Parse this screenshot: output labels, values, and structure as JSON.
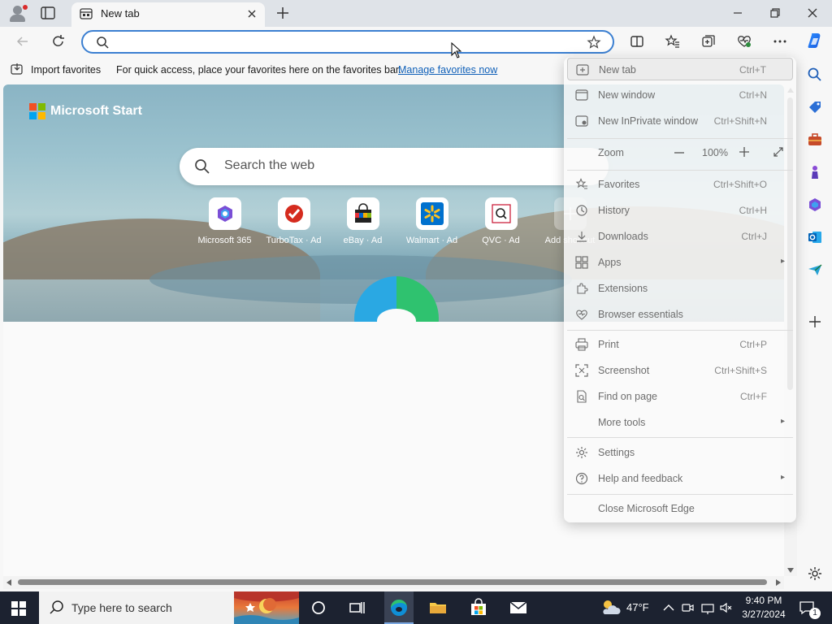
{
  "browser": {
    "tab_title": "New tab",
    "address_value": "",
    "favorites_bar": {
      "import_label": "Import favorites",
      "message": "For quick access, place your favorites here on the favorites bar.",
      "manage_link": "Manage favorites now"
    }
  },
  "newtab_page": {
    "brand": "Microsoft Start",
    "search_placeholder": "Search the web",
    "quick_links": [
      {
        "name": "Microsoft 365",
        "ad": ""
      },
      {
        "name": "TurboTax",
        "ad": "Ad"
      },
      {
        "name": "eBay",
        "ad": "Ad"
      },
      {
        "name": "Walmart",
        "ad": "Ad"
      },
      {
        "name": "QVC",
        "ad": "Ad"
      },
      {
        "name": "Add shortcut",
        "ad": ""
      }
    ]
  },
  "menu": {
    "new_tab": {
      "label": "New tab",
      "shortcut": "Ctrl+T"
    },
    "new_window": {
      "label": "New window",
      "shortcut": "Ctrl+N"
    },
    "new_inprivate": {
      "label": "New InPrivate window",
      "shortcut": "Ctrl+Shift+N"
    },
    "zoom": {
      "label": "Zoom",
      "value": "100%"
    },
    "favorites": {
      "label": "Favorites",
      "shortcut": "Ctrl+Shift+O"
    },
    "history": {
      "label": "History",
      "shortcut": "Ctrl+H"
    },
    "downloads": {
      "label": "Downloads",
      "shortcut": "Ctrl+J"
    },
    "apps": {
      "label": "Apps"
    },
    "extensions": {
      "label": "Extensions"
    },
    "browser_essentials": {
      "label": "Browser essentials"
    },
    "print": {
      "label": "Print",
      "shortcut": "Ctrl+P"
    },
    "screenshot": {
      "label": "Screenshot",
      "shortcut": "Ctrl+Shift+S"
    },
    "find_on_page": {
      "label": "Find on page",
      "shortcut": "Ctrl+F"
    },
    "more_tools": {
      "label": "More tools"
    },
    "settings": {
      "label": "Settings"
    },
    "help_feedback": {
      "label": "Help and feedback"
    },
    "close_edge": {
      "label": "Close Microsoft Edge"
    }
  },
  "taskbar": {
    "search_placeholder": "Type here to search",
    "weather": "47°F",
    "time": "9:40 PM",
    "date": "3/27/2024",
    "notification_count": "1"
  },
  "colors": {
    "accent": "#3b7fd1",
    "link": "#1060b8",
    "taskbar": "#1c2230"
  }
}
